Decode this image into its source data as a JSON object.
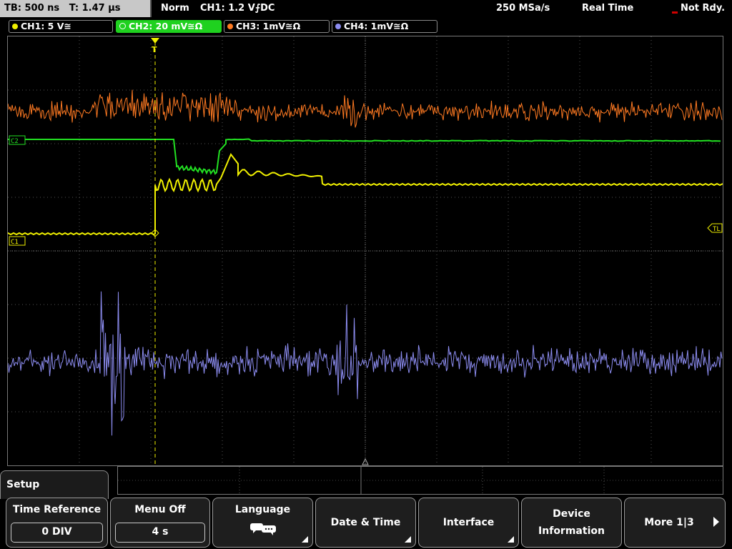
{
  "status": {
    "timebase": "TB: 500 ns",
    "trigger_time": "T: 1.47 µs",
    "mode": "Norm",
    "trigger_source": "CH1: 1.2 V",
    "trigger_slope": "⨍",
    "coupling": "DC",
    "sample_rate": "250 MSa/s",
    "acq_mode": "Real Time",
    "trigger_state": "Not Rdy."
  },
  "channels": [
    {
      "label": "CH1: 5 V",
      "coupling_sym": "≅",
      "color": "#f0f000",
      "active": false
    },
    {
      "label": "CH2: 20 mV",
      "coupling_sym": "≅Ω",
      "color": "#22e022",
      "active": true
    },
    {
      "label": "CH3: 1mV",
      "coupling_sym": "≅Ω",
      "color": "#ff7a22",
      "active": false
    },
    {
      "label": "CH4: 1mV",
      "coupling_sym": "≅Ω",
      "color": "#8c8cf0",
      "active": false
    }
  ],
  "markers": {
    "ch2": "C2",
    "ch1": "C1",
    "trigger_level": "TL",
    "trigger_pos": "T"
  },
  "menu": {
    "title": "Setup",
    "softkeys": [
      {
        "label": "Time Reference",
        "value": "0 DIV"
      },
      {
        "label": "Menu Off",
        "value": "4 s"
      },
      {
        "label": "Language",
        "icon": "speech-bubbles-icon"
      },
      {
        "label": "Date & Time"
      },
      {
        "label": "Interface"
      },
      {
        "label": "Device",
        "label2": "Information"
      },
      {
        "label": "More 1|3",
        "icon": "arrow-right-icon"
      }
    ]
  },
  "colors": {
    "ch1": "#f0f000",
    "ch2": "#22e022",
    "ch3": "#ff7a22",
    "ch4": "#8c8cf0",
    "grid": "#555555"
  }
}
